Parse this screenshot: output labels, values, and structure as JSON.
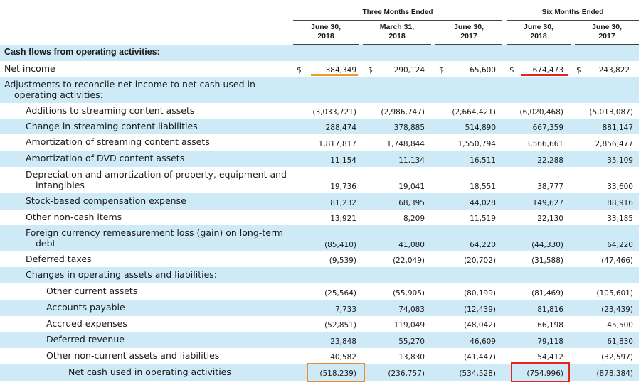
{
  "header": {
    "three_months": "Three Months Ended",
    "six_months": "Six Months Ended",
    "columns": [
      {
        "line1": "June 30,",
        "line2": "2018"
      },
      {
        "line1": "March 31,",
        "line2": "2018"
      },
      {
        "line1": "June 30,",
        "line2": "2017"
      },
      {
        "line1": "June 30,",
        "line2": "2018"
      },
      {
        "line1": "June 30,",
        "line2": "2017"
      }
    ]
  },
  "section_title": "Cash flows from operating activities:",
  "net_income": {
    "label": "Net income",
    "currency": "$",
    "values": [
      "384,349",
      "290,124",
      "65,600",
      "674,473",
      "243,822"
    ]
  },
  "adjustments_label_1": "Adjustments to reconcile net income to net cash used in",
  "adjustments_label_2": "operating activities:",
  "rows": [
    {
      "label": "Additions to streaming content assets",
      "values": [
        "(3,033,721)",
        "(2,986,747)",
        "(2,664,421)",
        "(6,020,468)",
        "(5,013,087)"
      ]
    },
    {
      "label": "Change in streaming content liabilities",
      "values": [
        "288,474",
        "378,885",
        "514,890",
        "667,359",
        "881,147"
      ]
    },
    {
      "label": "Amortization of streaming content assets",
      "values": [
        "1,817,817",
        "1,748,844",
        "1,550,794",
        "3,566,661",
        "2,856,477"
      ]
    },
    {
      "label": "Amortization of DVD content assets",
      "values": [
        "11,154",
        "11,134",
        "16,511",
        "22,288",
        "35,109"
      ]
    },
    {
      "label": "Depreciation and amortization of property, equipment and",
      "label2": "intangibles",
      "values": [
        "19,736",
        "19,041",
        "18,551",
        "38,777",
        "33,600"
      ]
    },
    {
      "label": "Stock-based compensation expense",
      "values": [
        "81,232",
        "68,395",
        "44,028",
        "149,627",
        "88,916"
      ]
    },
    {
      "label": "Other non-cash items",
      "values": [
        "13,921",
        "8,209",
        "11,519",
        "22,130",
        "33,185"
      ]
    },
    {
      "label": "Foreign currency remeasurement loss (gain) on long-term",
      "label2": "debt",
      "values": [
        "(85,410)",
        "41,080",
        "64,220",
        "(44,330)",
        "64,220"
      ]
    },
    {
      "label": "Deferred taxes",
      "values": [
        "(9,539)",
        "(22,049)",
        "(20,702)",
        "(31,588)",
        "(47,466)"
      ]
    },
    {
      "label": "Changes in operating assets and liabilities:",
      "values": [
        "",
        "",
        "",
        "",
        ""
      ]
    },
    {
      "label": "Other current assets",
      "values": [
        "(25,564)",
        "(55,905)",
        "(80,199)",
        "(81,469)",
        "(105,601)"
      ]
    },
    {
      "label": "Accounts payable",
      "values": [
        "7,733",
        "74,083",
        "(12,439)",
        "81,816",
        "(23,439)"
      ]
    },
    {
      "label": "Accrued expenses",
      "values": [
        "(52,851)",
        "119,049",
        "(48,042)",
        "66,198",
        "45,500"
      ]
    },
    {
      "label": "Deferred revenue",
      "values": [
        "23,848",
        "55,270",
        "46,609",
        "79,118",
        "61,830"
      ]
    },
    {
      "label": "Other non-current assets and liabilities",
      "values": [
        "40,582",
        "13,830",
        "(41,447)",
        "54,412",
        "(32,597)"
      ]
    }
  ],
  "net_cash": {
    "label": "Net cash used in operating activities",
    "values": [
      "(518,239)",
      "(236,757)",
      "(534,528)",
      "(754,996)",
      "(878,384)"
    ]
  },
  "highlight_colors": {
    "orange": "#ee8a2b",
    "red": "#e0261d",
    "shade": "#cfeaf7"
  }
}
